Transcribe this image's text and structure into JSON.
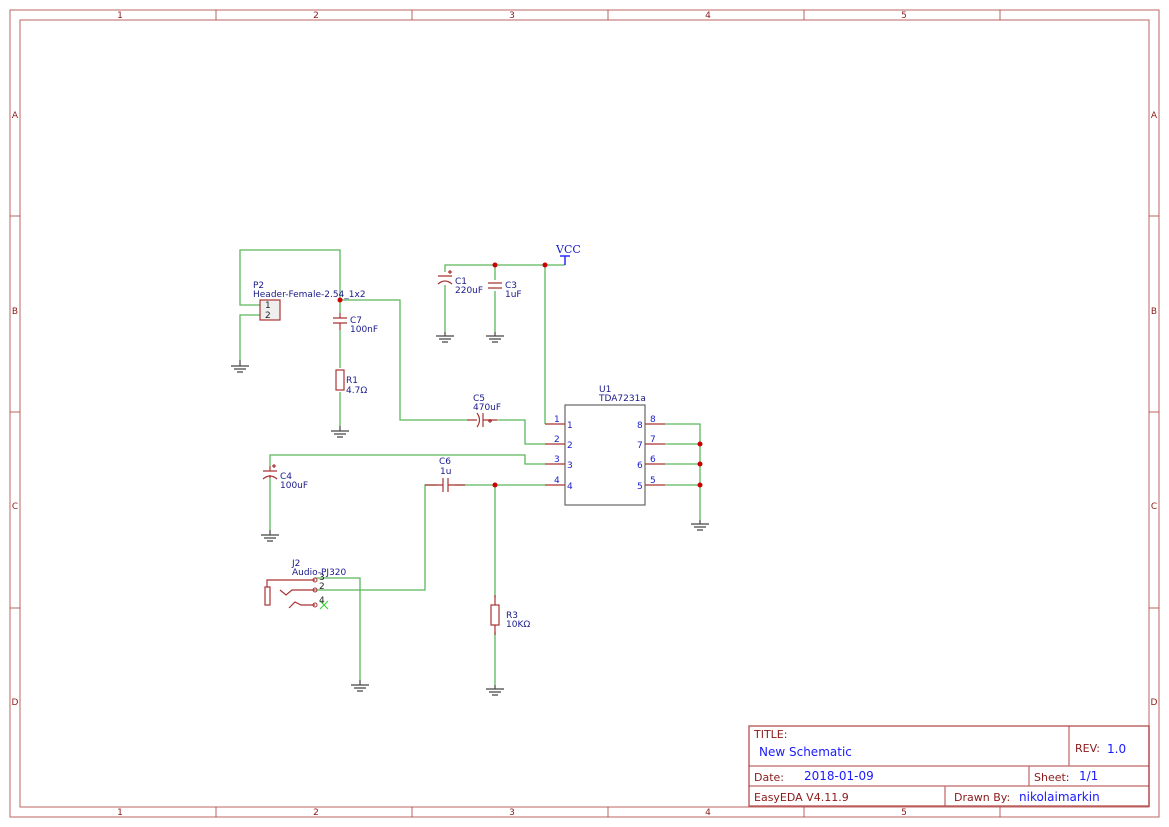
{
  "sheet": {
    "columns": [
      "1",
      "2",
      "3",
      "4",
      "5"
    ],
    "rows": [
      "A",
      "B",
      "C",
      "D"
    ],
    "colors": {
      "frame": "#aa3333",
      "wire": "#5cb85c",
      "component": "#aa3333",
      "label": "#1a1a8a",
      "junction": "#cc0000"
    }
  },
  "components": {
    "p2": {
      "ref": "P2",
      "value": "Header-Female-2.54_1x2",
      "pins": [
        "1",
        "2"
      ]
    },
    "c7": {
      "ref": "C7",
      "value": "100nF"
    },
    "r1": {
      "ref": "R1",
      "value": "4.7Ω"
    },
    "c1": {
      "ref": "C1",
      "value": "220uF"
    },
    "c3": {
      "ref": "C3",
      "value": "1uF"
    },
    "vcc": {
      "label": "VCC"
    },
    "c5": {
      "ref": "C5",
      "value": "470uF"
    },
    "u1": {
      "ref": "U1",
      "value": "TDA7231a",
      "left_pins": [
        "1",
        "2",
        "3",
        "4"
      ],
      "right_pins": [
        "8",
        "7",
        "6",
        "5"
      ]
    },
    "c4": {
      "ref": "C4",
      "value": "100uF"
    },
    "c6": {
      "ref": "C6",
      "value": "1u"
    },
    "j2": {
      "ref": "J2",
      "value": "Audio-PJ320",
      "pins": [
        "3",
        "2",
        "4"
      ]
    },
    "r3": {
      "ref": "R3",
      "value": "10KΩ"
    }
  },
  "title_block": {
    "title_label": "TITLE:",
    "title": "New Schematic",
    "rev_label": "REV:",
    "rev": "1.0",
    "date_label": "Date:",
    "date": "2018-01-09",
    "sheet_label": "Sheet:",
    "sheet": "1/1",
    "software": "EasyEDA V4.11.9",
    "drawn_by_label": "Drawn By:",
    "drawn_by": "nikolaimarkin"
  }
}
